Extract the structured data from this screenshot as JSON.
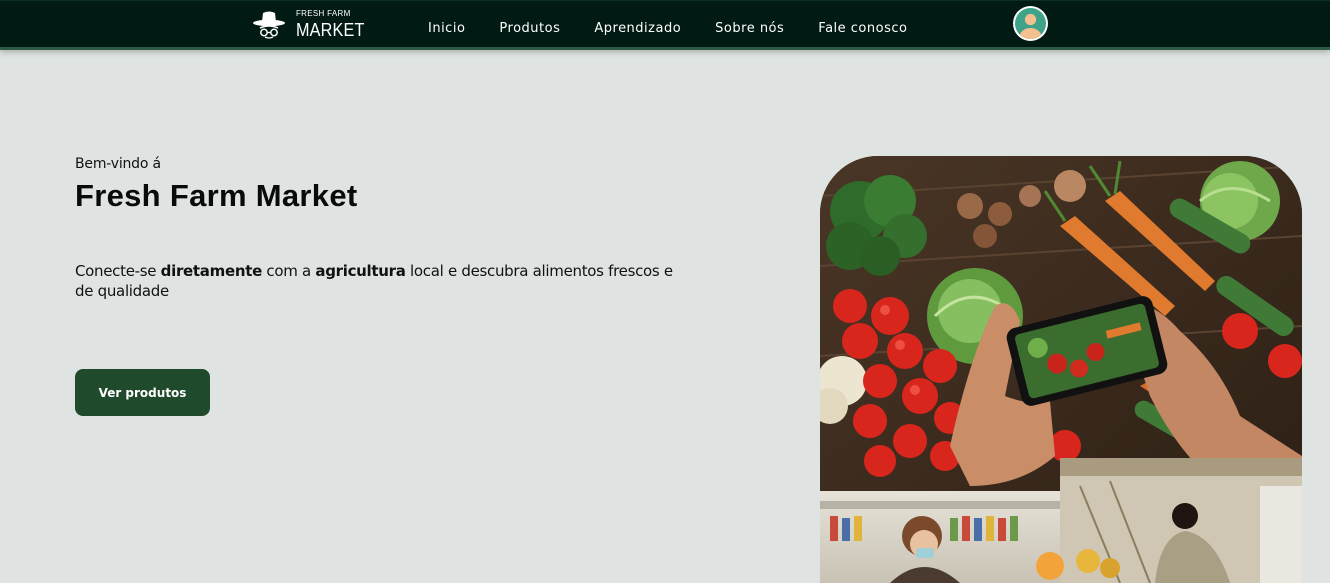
{
  "brand": {
    "line1": "FRESH FARM",
    "line2": "MARKET",
    "logo_icon": "farmer-hat-icon"
  },
  "nav": {
    "items": [
      "Inicio",
      "Produtos",
      "Aprendizado",
      "Sobre nós",
      "Fale conosco"
    ]
  },
  "user": {
    "icon": "user-avatar-icon"
  },
  "hero": {
    "greeting": "Bem-vindo á",
    "title": "Fresh Farm Market",
    "desc_1": "Conecte-se ",
    "desc_bold_1": "diretamente",
    "desc_2": " com a ",
    "desc_bold_2": "agricultura",
    "desc_3": " local e descubra alimentos frescos e de qualidade",
    "cta_label": "Ver produtos"
  },
  "colors": {
    "nav_bg": "#021a14",
    "page_bg": "#dfe4e2",
    "cta_bg": "#1f4a2c",
    "avatar_ring": "#3fa38a"
  }
}
